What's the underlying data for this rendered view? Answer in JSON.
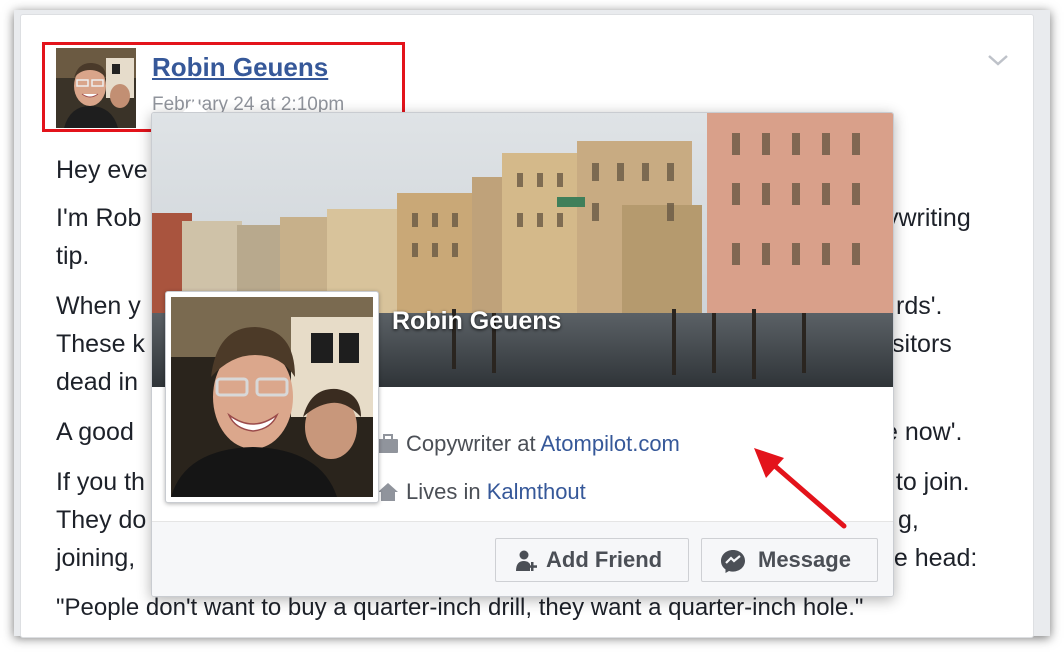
{
  "post": {
    "author": "Robin Geuens",
    "date": "February 24 at 2:10pm",
    "lines": [
      "Hey eve",
      "I'm Rob",
      "ywriting",
      "tip.",
      "When y",
      "rds'.",
      "These k",
      "visitors",
      "dead in",
      "A good",
      "e now'.",
      "If you th",
      "t to join.",
      "They do",
      "g,",
      "joining,",
      "ne head:",
      "\"People don't want to buy a quarter-inch drill, they want a quarter-inch hole.\""
    ]
  },
  "hovercard": {
    "name": "Robin Geuens",
    "work_prefix": "Copywriter at ",
    "work_link": "Atompilot.com",
    "lives_prefix": "Lives in ",
    "lives_link": "Kalmthout",
    "add_friend_label": "Add Friend",
    "message_label": "Message"
  },
  "colors": {
    "link": "#365899",
    "highlight_box": "#e3131b",
    "annotation_arrow": "#e3131b"
  },
  "icons": [
    "chevron-down-icon",
    "briefcase-icon",
    "house-icon",
    "add-friend-icon",
    "messenger-icon"
  ]
}
